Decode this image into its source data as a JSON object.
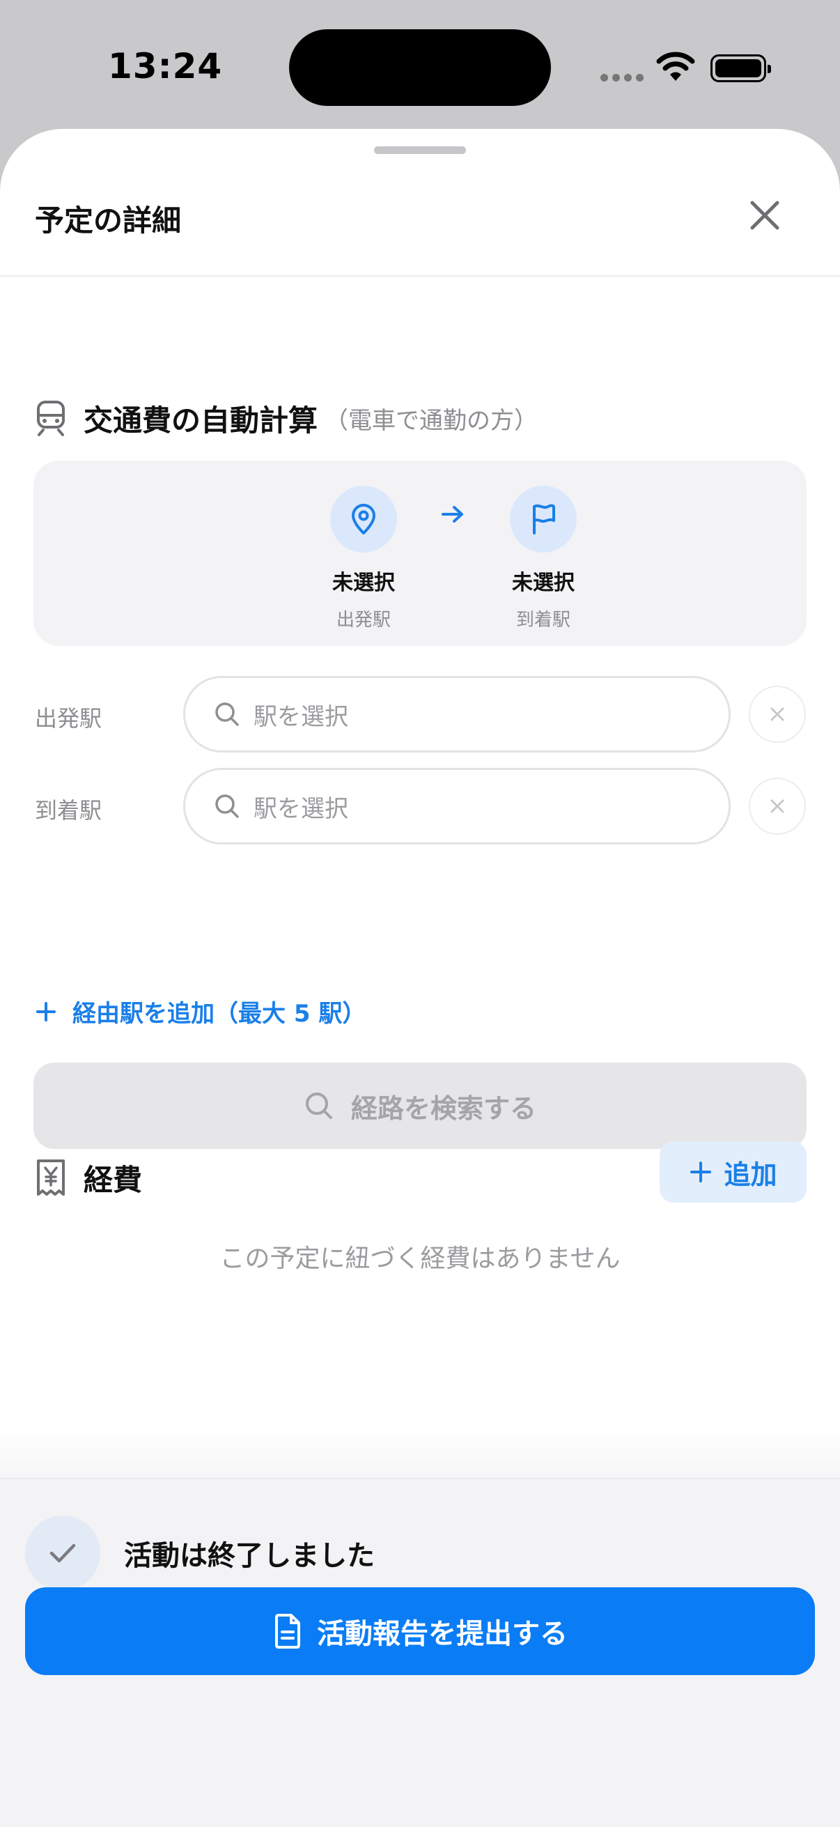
{
  "status_bar": {
    "time": "13:24"
  },
  "sheet": {
    "title": "予定の詳細"
  },
  "transport": {
    "title": "交通費の自動計算",
    "subtitle": "（電車で通勤の方）",
    "from": {
      "value": "未選択",
      "label": "出発駅",
      "icon": "map-pin-icon"
    },
    "to": {
      "value": "未選択",
      "label": "到着駅",
      "icon": "flag-icon"
    },
    "departure_field": {
      "label": "出発駅",
      "placeholder": "駅を選択"
    },
    "arrival_field": {
      "label": "到着駅",
      "placeholder": "駅を選択"
    },
    "add_via_label": "経由駅を追加（最大 5 駅）",
    "search_button_label": "経路を検索する"
  },
  "expenses": {
    "title": "経費",
    "add_button_label": "追加",
    "empty_text": "この予定に紐づく経費はありません"
  },
  "footer": {
    "done_text": "活動は終了しました",
    "submit_label": "活動報告を提出する"
  },
  "colors": {
    "accent": "#0a7cf5",
    "accent_text": "#1a7fe8",
    "accent_bg": "#e2eefb",
    "muted_text": "#8e8e93"
  }
}
